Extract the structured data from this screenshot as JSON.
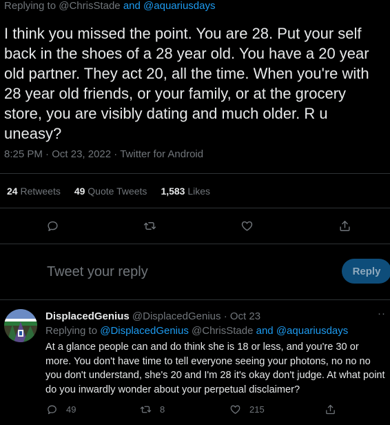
{
  "main_tweet": {
    "replying_prefix": "Replying to",
    "replying_user1": "@ChrisStade",
    "replying_and": "and",
    "replying_user2": "@aquariusdays",
    "text": "I think you missed the point. You are 28. Put your self back in the shoes of a 28 year old. You have a 20 year old partner. They act 20, all the time. When you're with 28 year old friends, or your family, or at the grocery store, you are visibly dating and much older. R u uneasy?",
    "time": "8:25 PM",
    "date": "Oct 23, 2022",
    "source": "Twitter for Android",
    "separator": "·"
  },
  "stats": {
    "retweets_count": "24",
    "retweets_label": "Retweets",
    "quotes_count": "49",
    "quotes_label": "Quote Tweets",
    "likes_count": "1,583",
    "likes_label": "Likes"
  },
  "actions": {
    "icons": [
      "reply-icon",
      "retweet-icon",
      "like-icon",
      "share-icon"
    ]
  },
  "reply_box": {
    "placeholder": "Tweet your reply",
    "button_label": "Reply"
  },
  "reply": {
    "display_name": "DisplacedGenius",
    "handle": "@DisplacedGenius",
    "separator": "·",
    "date": "Oct 23",
    "more": "··",
    "replying_prefix": "Replying to",
    "replying_user1": "@DisplacedGenius",
    "replying_user2": "@ChrisStade",
    "replying_and": "and",
    "replying_user3": "@aquariusdays",
    "text": "At a glance people can and do think she is 18 or less, and you're 30 or more. You don't have time to tell everyone seeing your photons, no no no you don't understand, she's 20 and I'm 28 it's okay don't judge. At what point do you inwardly wonder about your perpetual disclaimer?",
    "reply_count": "49",
    "retweet_count": "8",
    "like_count": "215"
  },
  "colors": {
    "background": "#000000",
    "text": "#e7e9ea",
    "muted": "#71767b",
    "link": "#1d9bf0",
    "reply_button": "#0e4d7a"
  }
}
